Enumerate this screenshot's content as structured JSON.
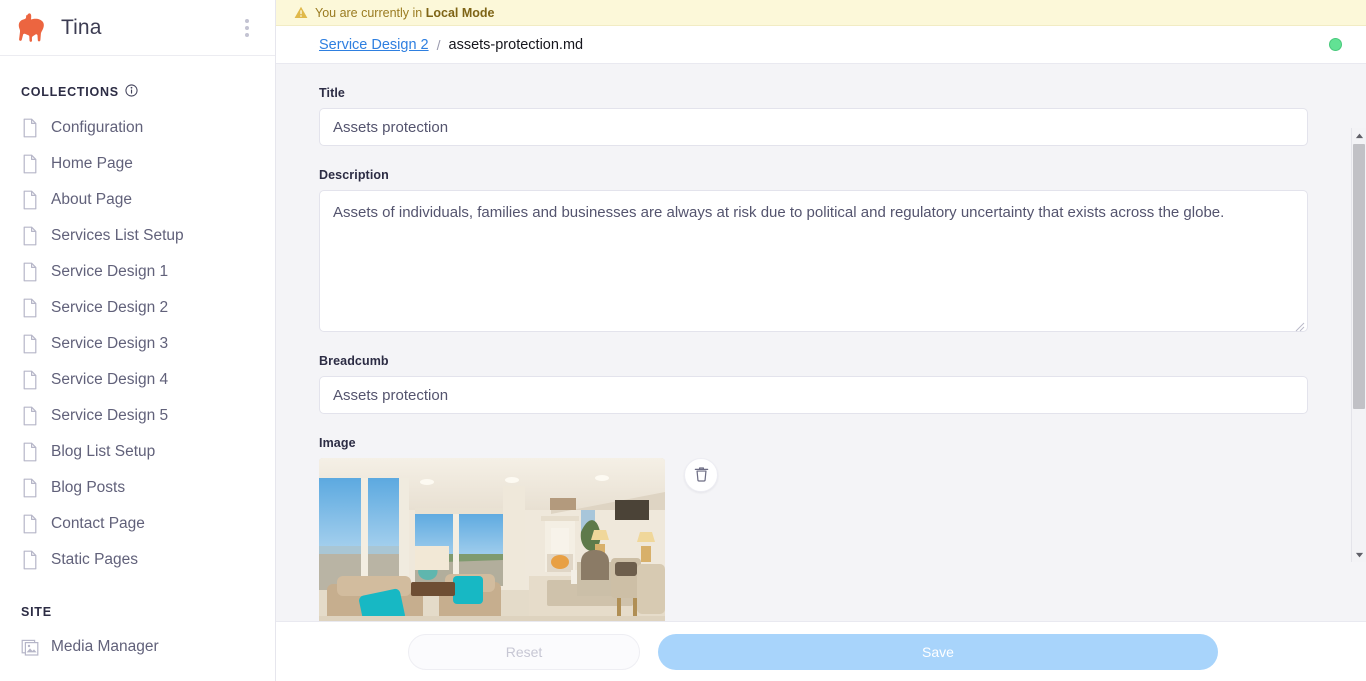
{
  "sidebar": {
    "brand": {
      "name": "Tina",
      "logo_icon": "llama-icon",
      "logo_color": "#ec6540"
    },
    "menu_icon": "kebab-menu-icon",
    "collections_header": {
      "label": "COLLECTIONS",
      "info_icon": "info-icon"
    },
    "collections": [
      {
        "label": "Configuration",
        "icon": "document-icon"
      },
      {
        "label": "Home Page",
        "icon": "document-icon"
      },
      {
        "label": "About Page",
        "icon": "document-icon"
      },
      {
        "label": "Services List Setup",
        "icon": "document-icon"
      },
      {
        "label": "Service Design 1",
        "icon": "document-icon"
      },
      {
        "label": "Service Design 2",
        "icon": "document-icon"
      },
      {
        "label": "Service Design 3",
        "icon": "document-icon"
      },
      {
        "label": "Service Design 4",
        "icon": "document-icon"
      },
      {
        "label": "Service Design 5",
        "icon": "document-icon"
      },
      {
        "label": "Blog List Setup",
        "icon": "document-icon"
      },
      {
        "label": "Blog Posts",
        "icon": "document-icon"
      },
      {
        "label": "Contact Page",
        "icon": "document-icon"
      },
      {
        "label": "Static Pages",
        "icon": "document-icon"
      }
    ],
    "site_header": {
      "label": "SITE"
    },
    "site_items": [
      {
        "label": "Media Manager",
        "icon": "image-icon"
      }
    ]
  },
  "banner": {
    "icon": "warning-triangle-icon",
    "text_prefix": "You are currently in ",
    "mode": "Local Mode",
    "bg_color": "#fcf8d9",
    "text_color": "#9a7b21"
  },
  "breadcrumb": {
    "parent": "Service Design 2",
    "separator": "/",
    "current": "assets-protection.md",
    "link_color": "#2e7fe0"
  },
  "status": {
    "indicator": "online-dot",
    "color": "#62e294"
  },
  "form": {
    "fields": [
      {
        "label": "Title",
        "value": "Assets protection",
        "type": "text"
      },
      {
        "label": "Description",
        "value": "Assets of individuals, families and businesses are always at risk due to political and regulatory uncertainty that exists across the globe.",
        "type": "textarea"
      },
      {
        "label": "Breadcumb",
        "value": "Assets protection",
        "type": "text"
      },
      {
        "label": "Image",
        "value": "",
        "type": "image"
      }
    ],
    "image_field": {
      "label": "Image",
      "alt": "Living room interior with large windows, beige sofas, teal pillows and a fireplace",
      "delete_icon": "trash-icon"
    }
  },
  "scrollbar": {
    "up_icon": "scroll-up-arrow-icon",
    "down_icon": "scroll-down-arrow-icon"
  },
  "actions": {
    "reset_label": "Reset",
    "save_label": "Save",
    "save_color": "#a8d4fb"
  }
}
